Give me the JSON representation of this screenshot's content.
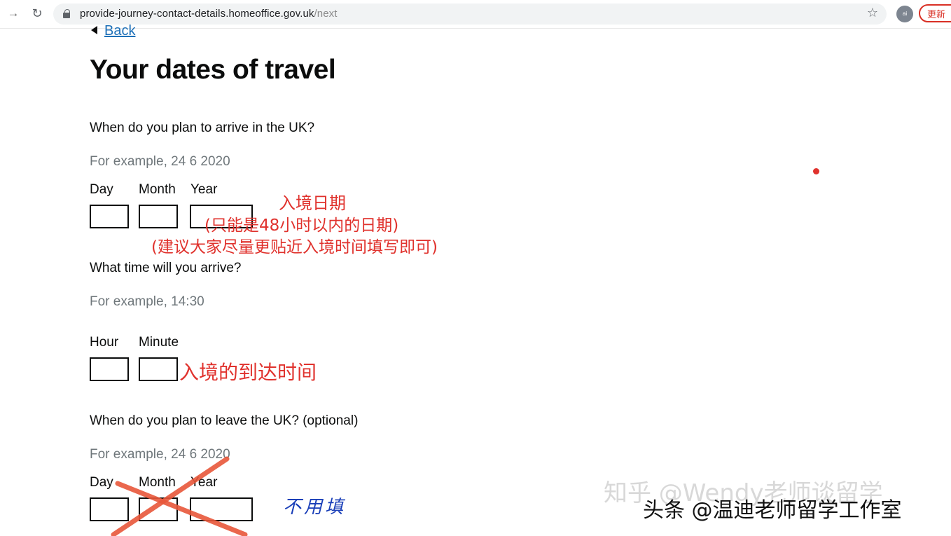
{
  "browser": {
    "url_host": "provide-journey-contact-details.homeoffice.gov.uk",
    "url_path": "/next",
    "profile_label": "ai",
    "update_label": "更新",
    "icons": [
      "back-arrow-icon",
      "reload-icon",
      "lock-icon",
      "bookmark-star-icon"
    ]
  },
  "page": {
    "back_label": "Back",
    "title": "Your dates of travel",
    "arrive": {
      "question": "When do you plan to arrive in the UK?",
      "hint": "For example, 24 6 2020",
      "day_label": "Day",
      "month_label": "Month",
      "year_label": "Year",
      "day_value": "",
      "month_value": "",
      "year_value": ""
    },
    "time": {
      "question": "What time will you arrive?",
      "hint": "For example, 14:30",
      "hour_label": "Hour",
      "minute_label": "Minute",
      "hour_value": "",
      "minute_value": ""
    },
    "leave": {
      "question": "When do you plan to leave the UK? (optional)",
      "hint": "For example, 24 6 2020",
      "day_label": "Day",
      "month_label": "Month",
      "year_label": "Year"
    }
  },
  "annotations": {
    "entry_date": "入境日期",
    "within_48h": "(只能是48小时以内的日期)",
    "suggestion": "(建议大家尽量更贴近入境时间填写即可)",
    "arrival_time": "入境的到达时间",
    "no_need": "不用填",
    "annotation_color": "#e0322d",
    "handwriting_color": "#1a3fb8"
  },
  "watermarks": {
    "zhihu": "知乎 @Wendy老师谈留学",
    "toutiao": "头条 @温迪老师留学工作室"
  }
}
